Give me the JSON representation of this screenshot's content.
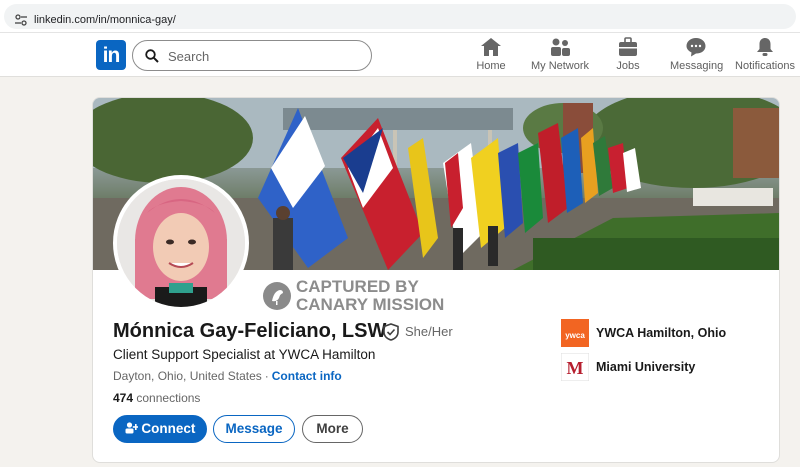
{
  "browser": {
    "url": "linkedin.com/in/monnica-gay/"
  },
  "nav": {
    "search_placeholder": "Search",
    "items": [
      {
        "label": "Home",
        "icon": "home-icon"
      },
      {
        "label": "My Network",
        "icon": "network-icon"
      },
      {
        "label": "Jobs",
        "icon": "briefcase-icon"
      },
      {
        "label": "Messaging",
        "icon": "messaging-icon"
      },
      {
        "label": "Notifications",
        "icon": "bell-icon"
      }
    ]
  },
  "profile": {
    "watermark_line1": "CAPTURED BY",
    "watermark_line2": "CANARY MISSION",
    "name": "Mónnica Gay-Feliciano, LSW",
    "pronouns": "She/Her",
    "headline": "Client Support Specialist at YWCA Hamilton",
    "location": "Dayton, Ohio, United States",
    "contact_info": "Contact info",
    "connections_count": "474",
    "connections_label": "connections",
    "buttons": {
      "connect": "Connect",
      "message": "Message",
      "more": "More"
    },
    "organizations": [
      {
        "name": "YWCA Hamilton, Ohio",
        "logo_text": "ywca",
        "color": "#f26522"
      },
      {
        "name": "Miami University",
        "logo_text": "M",
        "color": "#b61e2e"
      }
    ]
  },
  "colors": {
    "accent": "#0a66c2",
    "page_bg": "#f4f2ee"
  }
}
